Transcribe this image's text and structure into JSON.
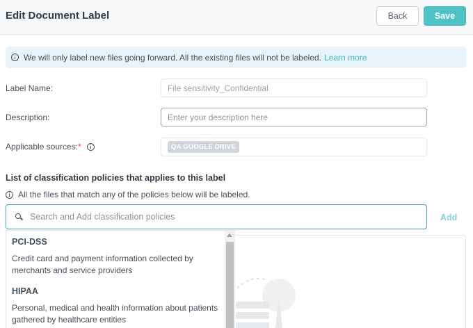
{
  "header": {
    "title": "Edit Document Label",
    "back_label": "Back",
    "save_label": "Save"
  },
  "info_banner": {
    "text": "We will only label new files going forward. All the existing files will not be labeled.",
    "link": "Learn more"
  },
  "form": {
    "label_name": {
      "label": "Label Name:",
      "value": "File sensitivity_Confidential"
    },
    "description": {
      "label": "Description:",
      "placeholder": "Enter your description here",
      "value": ""
    },
    "sources": {
      "label": "Applicable sources:",
      "required_mark": "*",
      "chip": "QA GOOGLE DRIVE"
    }
  },
  "policies": {
    "section_title": "List of classification policies that applies to this label",
    "note": "All the files that match any of the policies below will be labeled.",
    "search_placeholder": "Search and Add classification policies",
    "add_label": "Add",
    "dropdown": [
      {
        "name": "PCI-DSS",
        "description": "Credit card and payment information collected by merchants and service providers"
      },
      {
        "name": "HIPAA",
        "description": "Personal, medical and health information about patients gathered by healthcare entities"
      }
    ]
  },
  "colors": {
    "accent": "#4fc2c8",
    "link": "#3eb3bb",
    "banner_bg": "#e8f3fb",
    "required": "#e0464b"
  },
  "icons": [
    "info-icon",
    "search-icon"
  ]
}
